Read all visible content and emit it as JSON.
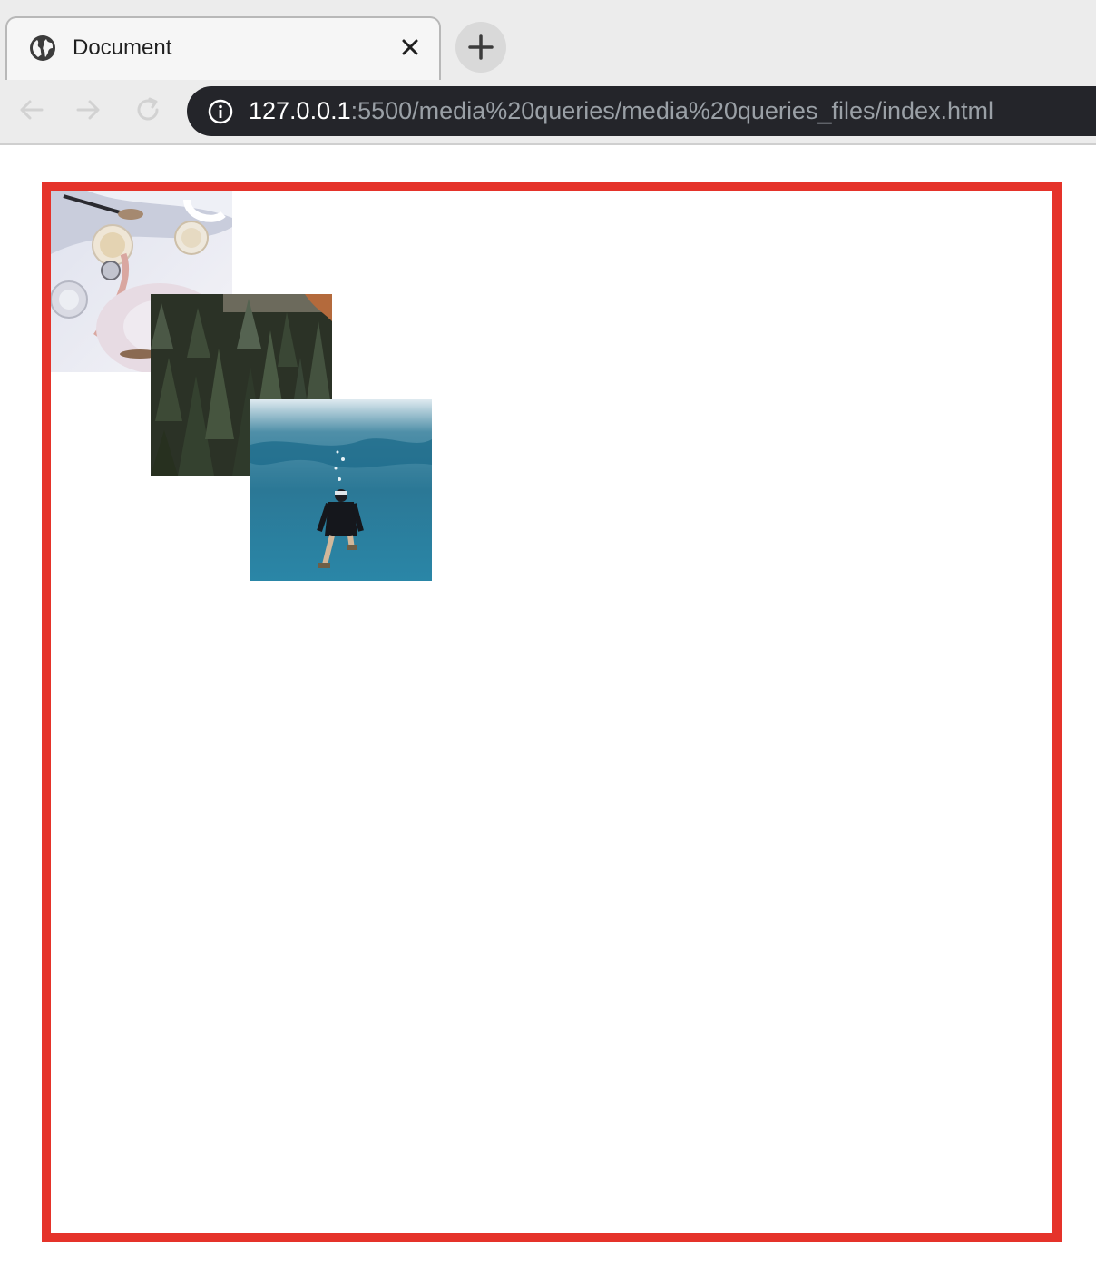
{
  "browser": {
    "tab": {
      "title": "Document",
      "icon": "globe-icon",
      "close_icon": "close-icon"
    },
    "new_tab_icon": "plus-icon",
    "nav": {
      "back_icon": "arrow-left-icon",
      "forward_icon": "arrow-right-icon",
      "reload_icon": "reload-icon"
    },
    "address": {
      "info_icon": "info-icon",
      "host": "127.0.0.1",
      "path": ":5500/media%20queries/media%20queries_files/index.html"
    }
  },
  "page": {
    "frame_border_color": "#e5332a",
    "images": [
      {
        "subject": "tabletop with watch, glass cups and saucers"
      },
      {
        "subject": "aerial view of pine forest"
      },
      {
        "subject": "underwater diver"
      }
    ]
  }
}
